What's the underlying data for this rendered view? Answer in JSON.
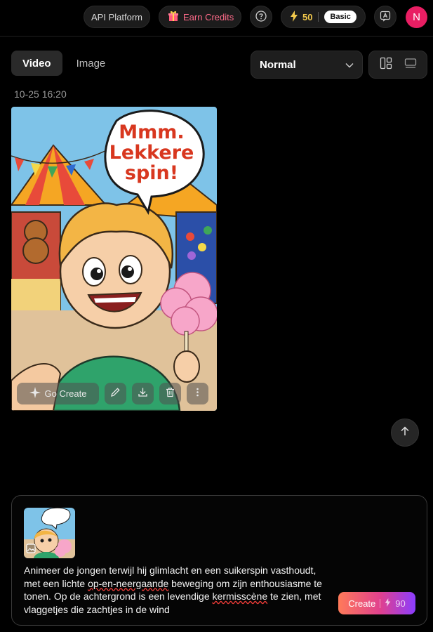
{
  "header": {
    "api_platform": "API Platform",
    "earn_credits": "Earn Credits",
    "credits": "50",
    "plan": "Basic",
    "avatar_initial": "N"
  },
  "tabs": [
    {
      "label": "Video",
      "active": true
    },
    {
      "label": "Image",
      "active": false
    }
  ],
  "quality_select": {
    "value": "Normal"
  },
  "gallery": {
    "timestamp": "10-25 16:20",
    "card": {
      "speech_bubble": [
        "Mmm.",
        "Lekkere",
        "spin!"
      ],
      "go_create_label": "Go Create"
    }
  },
  "composer": {
    "prompt_parts": [
      "Animeer de jongen terwijl hij glimlacht en een suikerspin vasthoudt, met een lichte ",
      "op-en-neergaande",
      " beweging om zijn enthousiasme te tonen. Op de achtergrond is een levendige ",
      "kermisscène",
      " te zien, met vlaggetjes die zachtjes in de wind"
    ],
    "create_label": "Create",
    "create_cost": "90"
  },
  "colors": {
    "accent_pink": "#e91e63",
    "credit_yellow": "#f2c94c",
    "earn_pink": "#ff6b8a"
  }
}
